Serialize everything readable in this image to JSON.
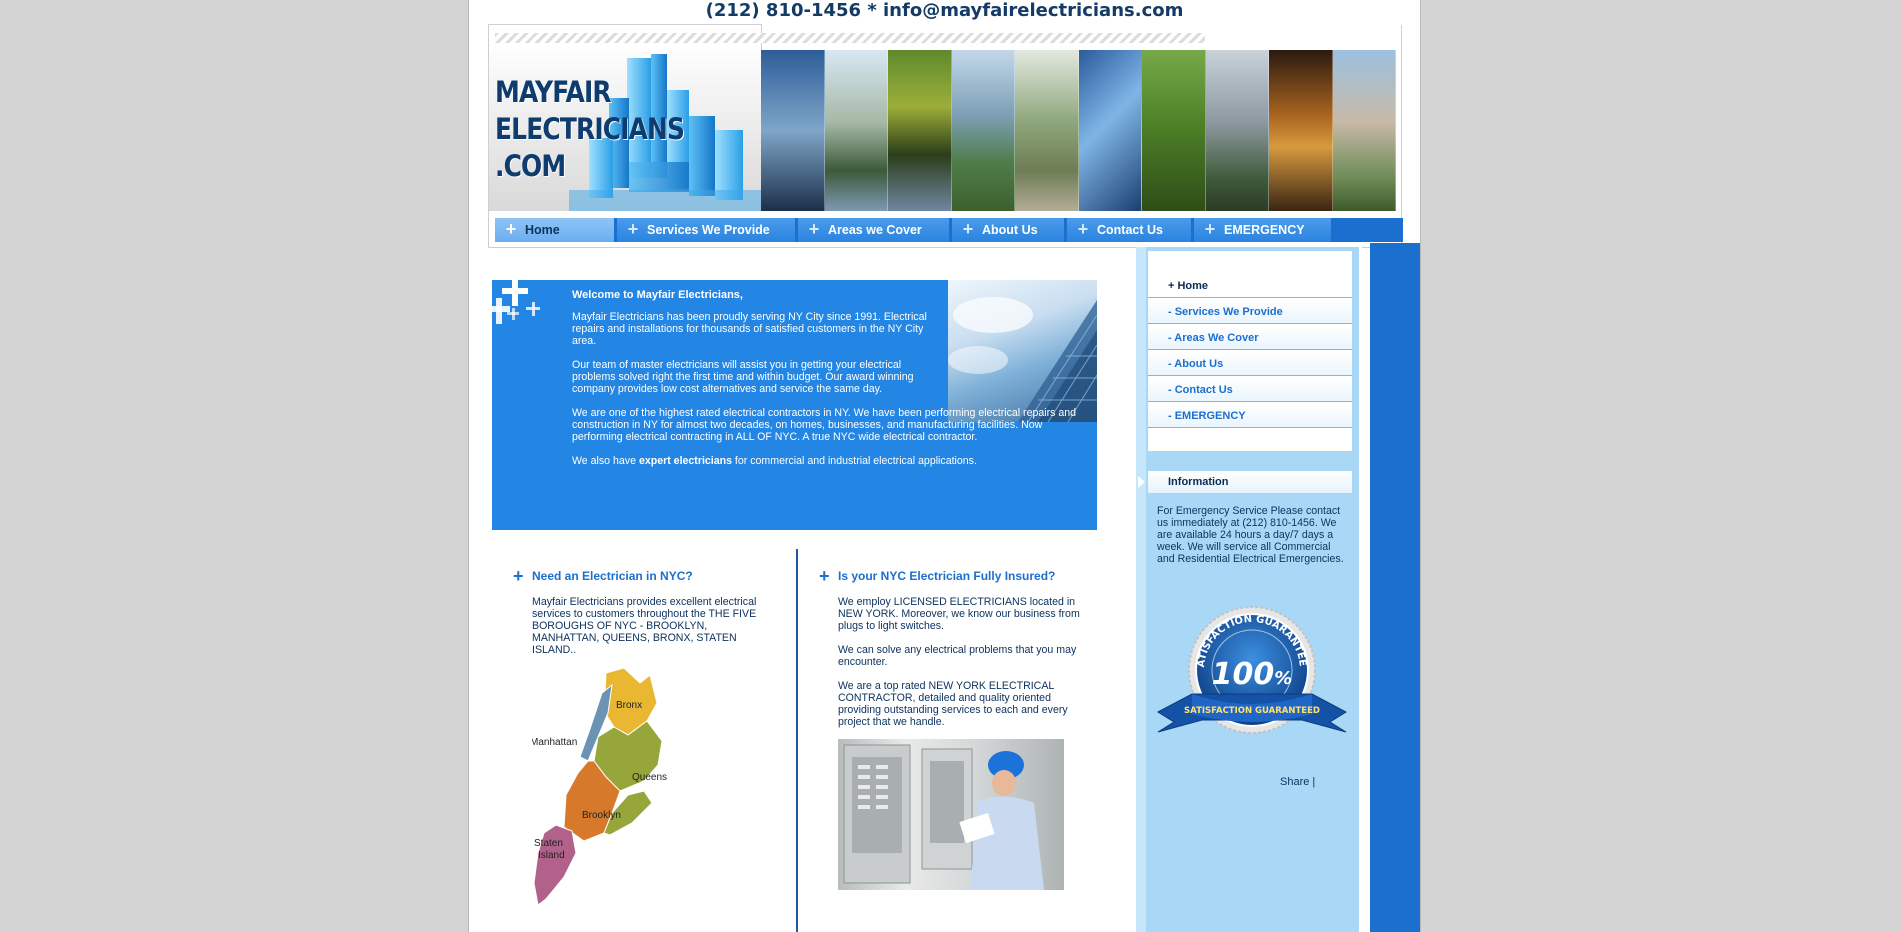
{
  "contact": {
    "phone": "(212) 810-1456",
    "separator": " * ",
    "email": "info@mayfairelectricians.com"
  },
  "logo": {
    "line1": "MAYFAIR",
    "line2": "ELECTRICIANS",
    "line3": ".COM"
  },
  "nav": {
    "items": [
      {
        "label": "Home",
        "active": true
      },
      {
        "label": "Services We Provide"
      },
      {
        "label": "Areas we Cover"
      },
      {
        "label": "About Us"
      },
      {
        "label": "Contact Us"
      },
      {
        "label": "EMERGENCY"
      }
    ]
  },
  "welcome": {
    "title": "Welcome to Mayfair Electricians,",
    "p1": "Mayfair Electricians has been proudly serving NY City since 1991. Electrical repairs and installations for thousands of satisfied customers in the NY City area.",
    "p2": "Our team of master electricians will assist you in getting your electrical problems solved right the first time and within budget. Our award winning company provides low cost alternatives and service the same day.",
    "p3": "We are one of the highest rated electrical contractors in NY. We have been performing electrical repairs and construction in NY for almost two decades, on homes, businesses, and manufacturing facilities. Now performing electrical contracting in ALL OF NYC. A true NYC wide electrical contractor.",
    "p4_pre": "We also have ",
    "p4_bold": "expert electricians",
    "p4_post": " for commercial and industrial electrical applications."
  },
  "left_column": {
    "heading": "Need an Electrician in NYC?",
    "text": "Mayfair Electricians provides excellent electrical services to customers throughout the THE FIVE BOROUGHS OF NYC - BROOKLYN, MANHATTAN, QUEENS, BRONX, STATEN ISLAND..",
    "map_labels": {
      "bronx": "Bronx",
      "manhattan": "Manhattan",
      "queens": "Queens",
      "brooklyn": "Brooklyn",
      "staten1": "Staten",
      "staten2": "Island"
    }
  },
  "right_column": {
    "heading": "Is your NYC Electrician Fully Insured?",
    "p1": "We employ LICENSED ELECTRICIANS located in NEW YORK. Moreover, we know our business from plugs to light switches.",
    "p2": "We can solve any electrical problems that you may encounter.",
    "p3": "We are a top rated NEW YORK ELECTRICAL CONTRACTOR, detailed and quality oriented providing outstanding services to each and every project that we handle."
  },
  "sidebar": {
    "menu": [
      {
        "label": "+ Home",
        "active": true
      },
      {
        "label": "- Services We Provide"
      },
      {
        "label": "- Areas We Cover"
      },
      {
        "label": "- About Us"
      },
      {
        "label": "- Contact Us"
      },
      {
        "label": "- EMERGENCY"
      }
    ],
    "info_heading": "Information",
    "info_text": "For Emergency Service Please contact us immediately at (212) 810-1456. We are available 24 hours a day/7 days a week. We will service all Commercial and Residential Electrical Emergencies.",
    "seal_top": "SATISFACTION GUARANTEED",
    "seal_number": "100",
    "seal_percent": "%",
    "seal_ribbon": "SATISFACTION GUARANTEED",
    "share": "Share |"
  },
  "colors": {
    "brand_blue": "#1a6fcf",
    "welcome_blue": "#2385e4",
    "sidebar_blue": "#a9d8f7",
    "text_navy": "#0f3460"
  }
}
